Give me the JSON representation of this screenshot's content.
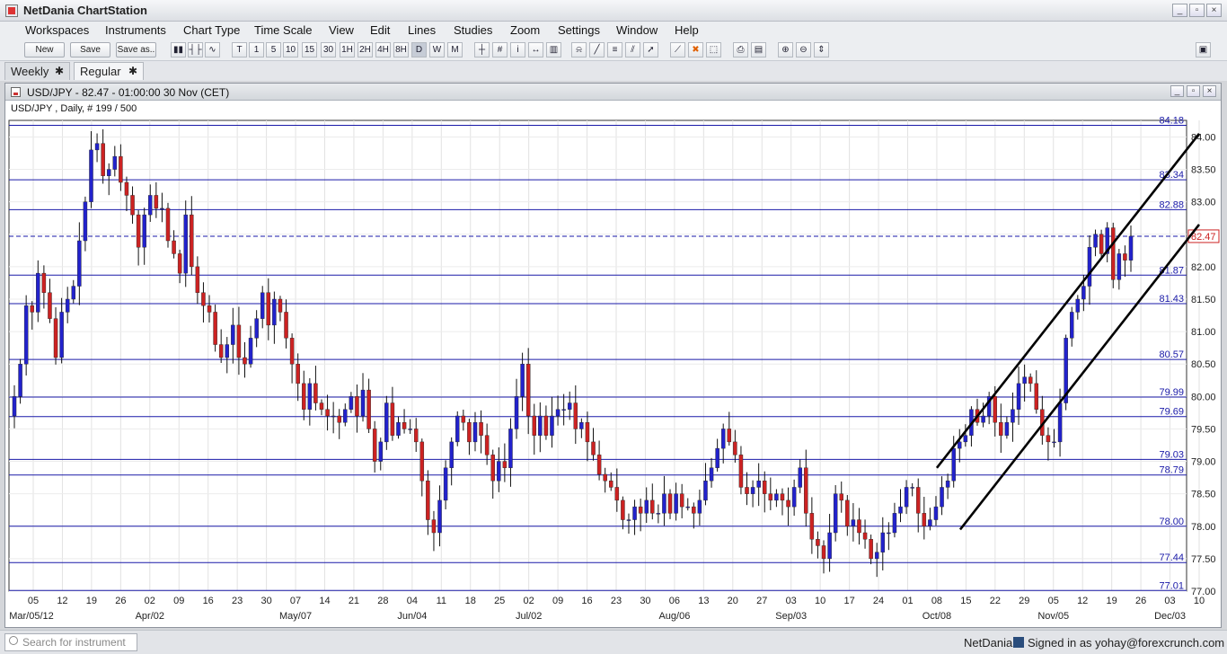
{
  "app": {
    "title": "NetDania ChartStation",
    "window_controls": [
      "_",
      "▫",
      "×"
    ]
  },
  "menu": [
    "Workspaces",
    "Instruments",
    "Chart Type",
    "Time Scale",
    "View",
    "Edit",
    "Lines",
    "Studies",
    "Zoom",
    "Settings",
    "Window",
    "Help"
  ],
  "toolbar": {
    "new_label": "New",
    "save_label": "Save",
    "save_as_label": "Save as..",
    "timeframes": [
      "T",
      "1",
      "5",
      "10",
      "15",
      "30",
      "1H",
      "2H",
      "4H",
      "8H",
      "D",
      "W",
      "M"
    ]
  },
  "tabs": [
    {
      "label": "Weekly",
      "close": "✱"
    },
    {
      "label": "Regular",
      "close": "✱"
    }
  ],
  "chart_window": {
    "title": "USD/JPY - 82.47 - 01:00:00  30 Nov (CET)",
    "controls": [
      "_",
      "▫",
      "×"
    ]
  },
  "chart_data": {
    "type": "candlestick",
    "instrument_label": "USD/JPY , Daily, # 199 / 500",
    "ylim": [
      77.0,
      84.2
    ],
    "y_ticks": [
      "84.00",
      "83.50",
      "83.00",
      "82.50",
      "82.00",
      "81.50",
      "81.00",
      "80.50",
      "80.00",
      "79.50",
      "79.00",
      "78.50",
      "78.00",
      "77.50",
      "77.00"
    ],
    "x_tick_labels": [
      "05",
      "12",
      "19",
      "26",
      "02",
      "09",
      "16",
      "23",
      "30",
      "07",
      "14",
      "21",
      "28",
      "04",
      "11",
      "18",
      "25",
      "02",
      "09",
      "16",
      "23",
      "30",
      "06",
      "13",
      "20",
      "27",
      "03",
      "10",
      "17",
      "24",
      "01",
      "08",
      "15",
      "22",
      "29",
      "05",
      "12",
      "19",
      "26",
      "03",
      "10"
    ],
    "month_labels": [
      {
        "label": "Mar/05/12",
        "tick": 0
      },
      {
        "label": "Apr/02",
        "tick": 4
      },
      {
        "label": "May/07",
        "tick": 9
      },
      {
        "label": "Jun/04",
        "tick": 13
      },
      {
        "label": "Jul/02",
        "tick": 17
      },
      {
        "label": "Aug/06",
        "tick": 22
      },
      {
        "label": "Sep/03",
        "tick": 26
      },
      {
        "label": "Oct/08",
        "tick": 31
      },
      {
        "label": "Nov/05",
        "tick": 35
      },
      {
        "label": "Dec/03",
        "tick": 39
      }
    ],
    "horizontal_levels": [
      {
        "value": 84.18,
        "label": "84.18"
      },
      {
        "value": 83.34,
        "label": "83.34"
      },
      {
        "value": 82.88,
        "label": "82.88"
      },
      {
        "value": 81.87,
        "label": "81.87"
      },
      {
        "value": 81.43,
        "label": "81.43"
      },
      {
        "value": 80.57,
        "label": "80.57"
      },
      {
        "value": 79.99,
        "label": "79.99"
      },
      {
        "value": 79.69,
        "label": "79.69"
      },
      {
        "value": 79.03,
        "label": "79.03"
      },
      {
        "value": 78.79,
        "label": "78.79"
      },
      {
        "value": 78.0,
        "label": "78.00"
      },
      {
        "value": 77.44,
        "label": "77.44"
      },
      {
        "value": 77.01,
        "label": "77.01"
      }
    ],
    "current_price": {
      "value": 82.47,
      "label": "82.47"
    },
    "trend_channel": [
      {
        "from": [
          "Oct/08",
          78.9
        ],
        "to": [
          "Dec/10",
          84.05
        ]
      },
      {
        "from": [
          "Oct/12",
          77.95
        ],
        "to": [
          "Dec/10",
          82.65
        ]
      }
    ],
    "up_color": "#2222cc",
    "down_color": "#cc2222",
    "level_color": "#1a1aa8",
    "closes": [
      80.0,
      80.5,
      81.4,
      81.3,
      81.9,
      81.6,
      81.2,
      80.6,
      81.3,
      81.5,
      81.7,
      82.4,
      83.0,
      83.8,
      83.9,
      83.4,
      83.5,
      83.7,
      83.3,
      83.1,
      82.8,
      82.3,
      82.8,
      83.1,
      82.9,
      82.9,
      82.4,
      82.2,
      81.9,
      82.8,
      82.0,
      81.6,
      81.4,
      81.3,
      80.8,
      80.6,
      80.8,
      81.1,
      80.6,
      80.5,
      80.9,
      81.2,
      81.6,
      81.1,
      81.5,
      81.3,
      80.9,
      80.5,
      80.2,
      79.8,
      80.2,
      79.9,
      79.8,
      79.7,
      79.7,
      79.6,
      79.8,
      80.0,
      79.7,
      80.1,
      79.5,
      79.0,
      79.3,
      79.9,
      79.4,
      79.6,
      79.5,
      79.5,
      79.3,
      78.7,
      78.1,
      77.9,
      78.4,
      78.9,
      79.3,
      79.7,
      79.6,
      79.3,
      79.6,
      79.4,
      79.1,
      78.7,
      79.0,
      78.9,
      79.5,
      80.0,
      80.5,
      79.7,
      79.4,
      79.7,
      79.4,
      79.7,
      79.8,
      79.8,
      79.9,
      79.5,
      79.6,
      79.3,
      79.1,
      78.8,
      78.7,
      78.6,
      78.4,
      78.1,
      78.1,
      78.3,
      78.2,
      78.4,
      78.2,
      78.2,
      78.5,
      78.2,
      78.5,
      78.3,
      78.3,
      78.2,
      78.4,
      78.7,
      78.9,
      79.2,
      79.5,
      79.3,
      79.1,
      78.6,
      78.5,
      78.6,
      78.7,
      78.5,
      78.4,
      78.5,
      78.4,
      78.3,
      78.6,
      78.9,
      78.2,
      77.8,
      77.7,
      77.5,
      77.9,
      78.5,
      78.4,
      78.0,
      78.1,
      77.9,
      77.8,
      77.5,
      77.6,
      77.9,
      77.9,
      78.2,
      78.3,
      78.6,
      78.6,
      78.2,
      78.0,
      78.1,
      78.3,
      78.6,
      78.7,
      79.2,
      79.3,
      79.4,
      79.8,
      79.6,
      79.7,
      80.0,
      79.6,
      79.4,
      79.6,
      79.8,
      80.2,
      80.3,
      80.2,
      79.8,
      79.4,
      79.3,
      79.3,
      79.9,
      80.9,
      81.3,
      81.5,
      81.7,
      82.3,
      82.5,
      82.2,
      82.6,
      81.8,
      82.2,
      82.1,
      82.47
    ],
    "ohlc_note": ""
  },
  "statusbar": {
    "search_placeholder": "Search for instrument",
    "brand": "NetDania",
    "login": "Signed in as yohay@forexcrunch.com"
  }
}
